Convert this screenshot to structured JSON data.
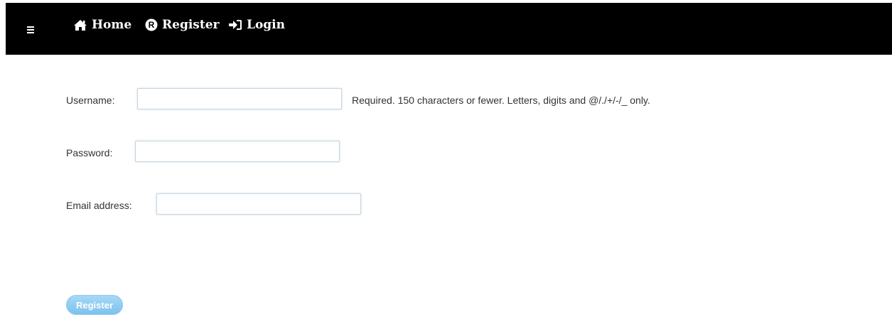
{
  "nav": {
    "home_label": "Home",
    "register_label": "Register",
    "login_label": "Login"
  },
  "form": {
    "username_label": "Username:",
    "username_value": "",
    "username_help": "Required. 150 characters or fewer. Letters, digits and @/./+/-/_ only.",
    "password_label": "Password:",
    "password_value": "",
    "email_label": "Email address:",
    "email_value": "",
    "submit_label": "Register"
  },
  "colors": {
    "navbar_bg": "#000000",
    "nav_text": "#ffffff",
    "button_bg": "#8ccdf2"
  },
  "icons": {
    "menu": "hamburger-icon",
    "home": "home-icon",
    "register": "registered-icon",
    "login": "sign-in-icon"
  }
}
